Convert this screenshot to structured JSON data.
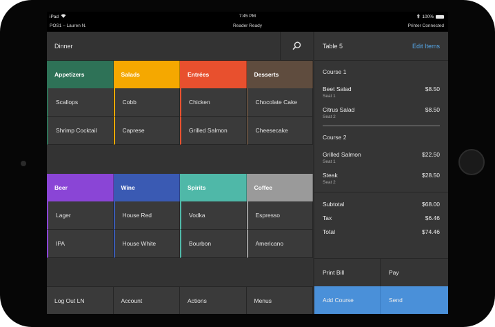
{
  "status_bar": {
    "device": "iPad",
    "time": "7:45 PM",
    "battery": "100%"
  },
  "info_bar": {
    "register": "POS1 – Lauren N.",
    "reader": "Reader Ready",
    "printer": "Printer Connected"
  },
  "menu": {
    "title": "Dinner",
    "food_categories": [
      {
        "label": "Appetizers",
        "color": "#2e7257",
        "items": [
          "Scallops",
          "Shrimp Cocktail"
        ]
      },
      {
        "label": "Salads",
        "color": "#f5a800",
        "items": [
          "Cobb",
          "Caprese"
        ]
      },
      {
        "label": "Entrées",
        "color": "#e8502e",
        "items": [
          "Chicken",
          "Grilled Salmon"
        ]
      },
      {
        "label": "Desserts",
        "color": "#5f4c3e",
        "items": [
          "Chocolate Cake",
          "Cheesecake"
        ]
      }
    ],
    "drink_categories": [
      {
        "label": "Beer",
        "color": "#8a45d6",
        "items": [
          "Lager",
          "IPA"
        ]
      },
      {
        "label": "Wine",
        "color": "#3a5ab3",
        "items": [
          "House Red",
          "House White"
        ]
      },
      {
        "label": "Spirits",
        "color": "#4fb8a8",
        "items": [
          "Vodka",
          "Bourbon"
        ]
      },
      {
        "label": "Coffee",
        "color": "#9a9a9a",
        "items": [
          "Espresso",
          "Americano"
        ]
      }
    ]
  },
  "bottom_nav": {
    "log_out": "Log Out LN",
    "account": "Account",
    "actions": "Actions",
    "menus": "Menus"
  },
  "ticket": {
    "table": "Table 5",
    "edit_items": "Edit Items",
    "courses": [
      {
        "label": "Course 1",
        "lines": [
          {
            "name": "Beet Salad",
            "seat": "Seat 1",
            "price": "$8.50"
          },
          {
            "name": "Citrus Salad",
            "seat": "Seat 2",
            "price": "$8.50"
          }
        ]
      },
      {
        "label": "Course 2",
        "lines": [
          {
            "name": "Grilled Salmon",
            "seat": "Seat 1",
            "price": "$22.50"
          },
          {
            "name": "Steak",
            "seat": "Seat 2",
            "price": "$28.50"
          }
        ]
      }
    ],
    "subtotal_label": "Subtotal",
    "subtotal": "$68.00",
    "tax_label": "Tax",
    "tax": "$6.46",
    "total_label": "Total",
    "total": "$74.46",
    "print_bill": "Print Bill",
    "pay": "Pay",
    "add_course": "Add Course",
    "send": "Send",
    "accent_color": "#4a90d9"
  }
}
